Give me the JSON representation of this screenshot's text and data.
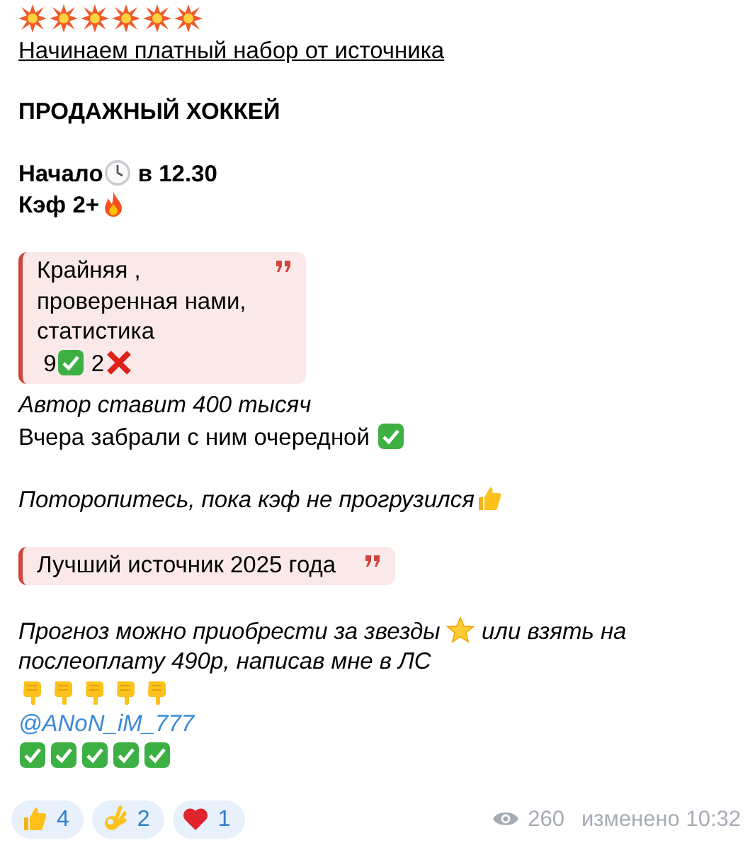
{
  "message": {
    "paragraphs": [
      [
        {
          "kind": "emoji",
          "segments": [
            {
              "kind": "burst"
            },
            {
              "kind": "burst"
            },
            {
              "kind": "burst"
            },
            {
              "kind": "burst"
            },
            {
              "kind": "burst"
            },
            {
              "kind": "burst"
            }
          ]
        },
        {
          "kind": "underline",
          "segments": [
            {
              "kind": "text",
              "text": "Начинаем платный набор от источника"
            }
          ]
        }
      ],
      [
        {
          "kind": "bold",
          "segments": [
            {
              "kind": "text",
              "text": "ПРОДАЖНЫЙ ХОККЕЙ"
            }
          ]
        }
      ],
      [
        {
          "kind": "bold",
          "segments": [
            {
              "kind": "text",
              "text": "Начало"
            },
            {
              "kind": "clock"
            },
            {
              "kind": "text",
              "text": " в 12.30"
            }
          ]
        },
        {
          "kind": "bold",
          "segments": [
            {
              "kind": "text",
              "text": "Кэф 2+"
            },
            {
              "kind": "fire"
            }
          ]
        }
      ],
      [
        {
          "kind": "quote",
          "lines": [
            [
              {
                "kind": "text",
                "text": "Крайняя ,"
              }
            ],
            [
              {
                "kind": "text",
                "text": "проверенная нами,"
              }
            ],
            [
              {
                "kind": "text",
                "text": "статистика"
              }
            ],
            [
              {
                "kind": "text",
                "text": " 9"
              },
              {
                "kind": "check"
              },
              {
                "kind": "text",
                "text": " 2"
              },
              {
                "kind": "cross"
              }
            ]
          ]
        },
        {
          "kind": "italic",
          "segments": [
            {
              "kind": "text",
              "text": "Автор ставит 400 тысяч"
            }
          ]
        },
        {
          "kind": "plain",
          "segments": [
            {
              "kind": "text",
              "text": "Вчера забрали с ним очередной "
            },
            {
              "kind": "check"
            }
          ]
        }
      ],
      [
        {
          "kind": "italic",
          "segments": [
            {
              "kind": "text",
              "text": "Поторопитесь, пока кэф не прогрузился"
            },
            {
              "kind": "thumbs"
            }
          ]
        }
      ],
      [
        {
          "kind": "quote",
          "lines": [
            [
              {
                "kind": "text",
                "text": "Лучший источник 2025 года"
              }
            ]
          ]
        }
      ],
      [
        {
          "kind": "italic",
          "segments": [
            {
              "kind": "text",
              "text": "Прогноз можно приобрести за звезды "
            },
            {
              "kind": "star"
            },
            {
              "kind": "text",
              "text": " или взять на"
            }
          ]
        },
        {
          "kind": "italic",
          "segments": [
            {
              "kind": "text",
              "text": "послеоплату 490р, написав мне в ЛС"
            }
          ]
        },
        {
          "kind": "emoji",
          "segments": [
            {
              "kind": "pointing"
            },
            {
              "kind": "pointing"
            },
            {
              "kind": "pointing"
            },
            {
              "kind": "pointing"
            },
            {
              "kind": "pointing"
            }
          ]
        },
        {
          "kind": "mention",
          "segments": [
            {
              "kind": "text",
              "text": "@ANoN_iM_777"
            }
          ]
        },
        {
          "kind": "emoji",
          "segments": [
            {
              "kind": "check"
            },
            {
              "kind": "check"
            },
            {
              "kind": "check"
            },
            {
              "kind": "check"
            },
            {
              "kind": "check"
            }
          ]
        }
      ]
    ],
    "reactions": [
      {
        "kind": "thumbs",
        "count": "4"
      },
      {
        "kind": "ok",
        "count": "2"
      },
      {
        "kind": "heart",
        "count": "1"
      }
    ],
    "views": "260",
    "edited": "изменено 10:32"
  }
}
